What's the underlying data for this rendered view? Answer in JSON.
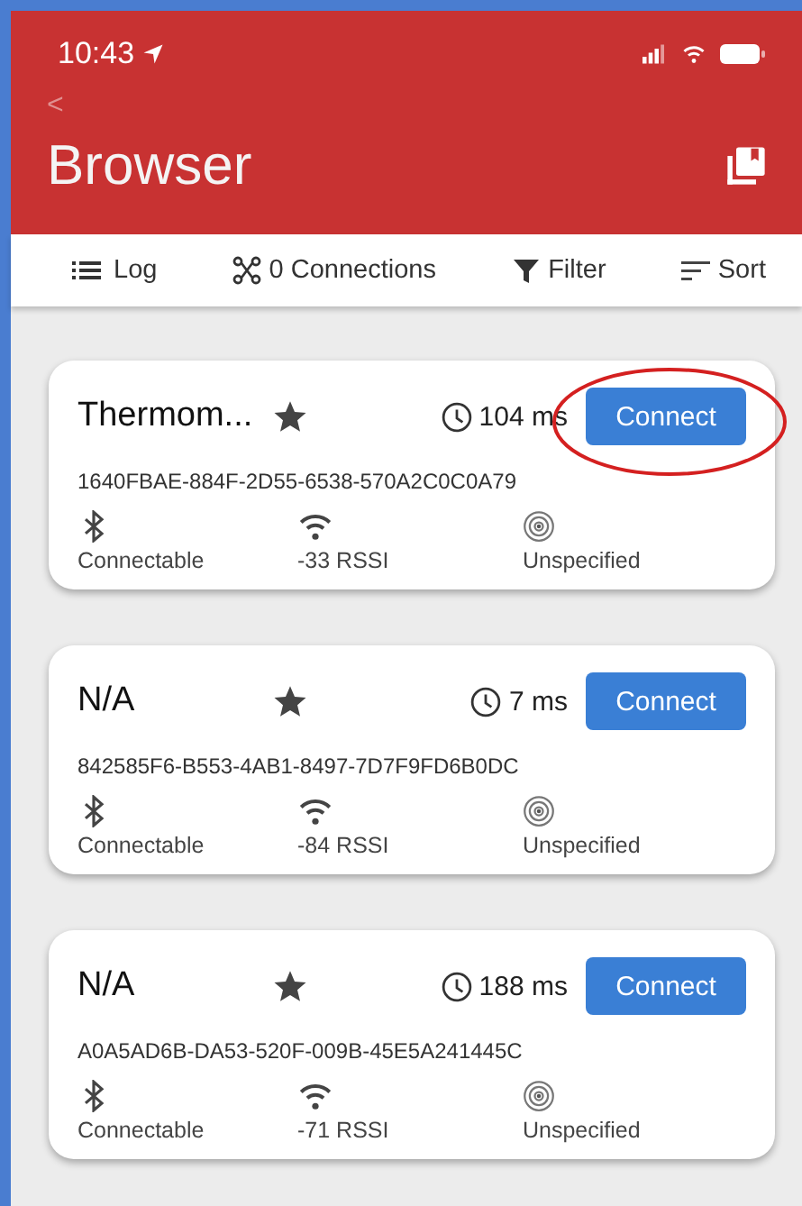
{
  "status_bar": {
    "time": "10:43"
  },
  "header": {
    "back": "<",
    "title": "Browser"
  },
  "toolbar": [
    {
      "kind": "log",
      "label": "Log"
    },
    {
      "kind": "connections",
      "label": "0 Connections"
    },
    {
      "kind": "filter",
      "label": "Filter"
    },
    {
      "kind": "sort",
      "label": "Sort"
    }
  ],
  "devices": [
    {
      "name": "Thermom...",
      "latency": "104 ms",
      "button": "Connect",
      "highlighted": true,
      "id": "1640FBAE-884F-2D55-6538-570A2C0C0A79",
      "connectable": "Connectable",
      "rssi": "-33 RSSI",
      "type": "Unspecified"
    },
    {
      "name": "N/A",
      "latency": "7 ms",
      "button": "Connect",
      "highlighted": false,
      "id": "842585F6-B553-4AB1-8497-7D7F9FD6B0DC",
      "connectable": "Connectable",
      "rssi": "-84 RSSI",
      "type": "Unspecified"
    },
    {
      "name": "N/A",
      "latency": "188 ms",
      "button": "Connect",
      "highlighted": false,
      "id": "A0A5AD6B-DA53-520F-009B-45E5A241445C",
      "connectable": "Connectable",
      "rssi": "-71 RSSI",
      "type": "Unspecified"
    }
  ]
}
